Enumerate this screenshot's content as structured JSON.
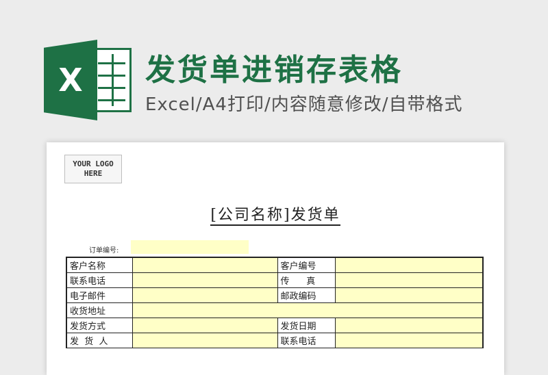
{
  "header": {
    "title": "发货单进销存表格",
    "subtitle": "Excel/A4打印/内容随意修改/自带格式",
    "logo_letter": "X"
  },
  "doc": {
    "logo_placeholder_line1": "YOUR LOGO",
    "logo_placeholder_line2": "HERE",
    "title": "[公司名称]发货单",
    "order_label": "订单编号:",
    "rows": [
      {
        "left_label": "客户名称",
        "right_label": "客户编号"
      },
      {
        "left_label": "联系电话",
        "right_label": "传      真"
      },
      {
        "left_label": "电子邮件",
        "right_label": "邮政编码"
      },
      {
        "left_label": "收货地址"
      },
      {
        "left_label": "发货方式",
        "right_label": "发货日期"
      },
      {
        "left_label": "发  货  人",
        "right_label": "联系电话"
      }
    ]
  },
  "colors": {
    "brand_green": "#1e7145",
    "input_yellow": "#ffffc7"
  }
}
